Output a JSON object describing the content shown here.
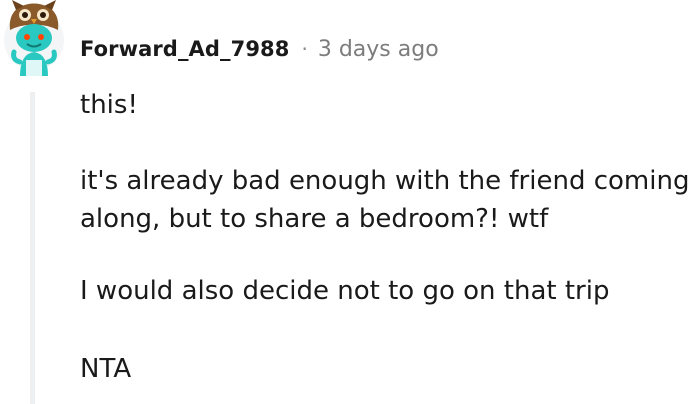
{
  "comment": {
    "avatar_icon": "owl-snoo-avatar-icon",
    "username": "Forward_Ad_7988",
    "separator": "·",
    "timestamp": "3 days ago",
    "paragraphs": [
      "this!",
      "it's already bad enough with the friend coming along, but to share a bedroom?! wtf",
      "I would also decide not to go on that trip",
      "NTA"
    ]
  },
  "colors": {
    "text": "#1a1a1b",
    "meta": "#7c7c7c",
    "thread_line": "#edeff1",
    "avatar_teal": "#29c8c0",
    "avatar_brown": "#8a5a2b"
  }
}
